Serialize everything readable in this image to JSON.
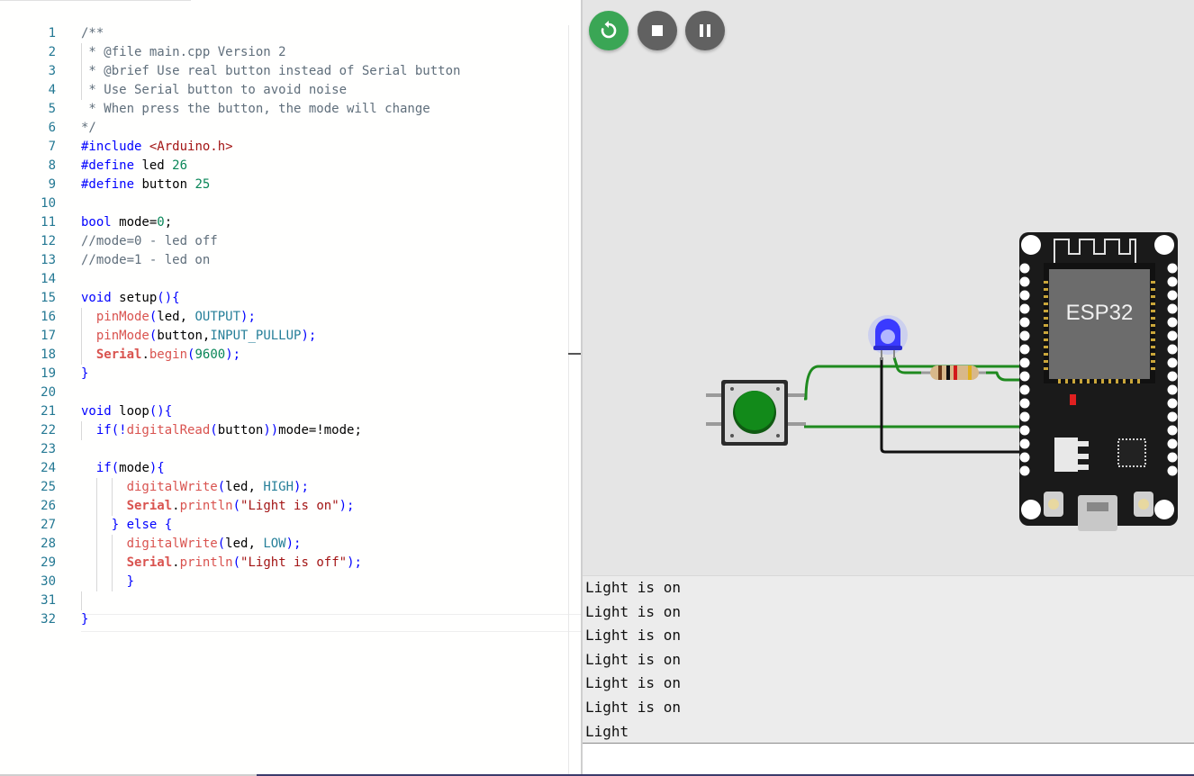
{
  "editor": {
    "lines": [
      "/**",
      " * @file main.cpp Version 2",
      " * @brief Use real button instead of Serial button",
      " * Use Serial button to avoid noise",
      " * When press the button, the mode will change",
      "*/",
      "#include <Arduino.h>",
      "#define led 26",
      "#define button 25",
      "",
      "bool mode=0;",
      "//mode=0 - led off",
      "//mode=1 - led on",
      "",
      "void setup(){",
      "  pinMode(led, OUTPUT);",
      "  pinMode(button,INPUT_PULLUP);",
      "  Serial.begin(9600);",
      "}",
      "",
      "void loop(){",
      "  if(!digitalRead(button))mode=!mode;",
      "",
      "  if(mode){",
      "      digitalWrite(led, HIGH);",
      "      Serial.println(\"Light is on\");",
      "    } else {",
      "      digitalWrite(led, LOW);",
      "      Serial.println(\"Light is off\");",
      "      }",
      "",
      "}"
    ],
    "line_numbers": [
      "1",
      "2",
      "3",
      "4",
      "5",
      "6",
      "7",
      "8",
      "9",
      "10",
      "11",
      "12",
      "13",
      "14",
      "15",
      "16",
      "17",
      "18",
      "19",
      "20",
      "21",
      "22",
      "23",
      "24",
      "25",
      "26",
      "27",
      "28",
      "29",
      "30",
      "31",
      "32"
    ]
  },
  "simulator": {
    "controls": {
      "restart_icon": "restart-icon",
      "stop_icon": "stop-icon",
      "pause_icon": "pause-icon"
    },
    "board_label": "ESP32",
    "colors": {
      "run_button": "#3aa655",
      "control_button": "#616161",
      "wire_green": "#1f8a1f",
      "wire_black": "#111111",
      "led_blue": "#3a3aff",
      "board": "#1a1a1a",
      "canvas": "#e5e5e5"
    }
  },
  "serial_monitor": {
    "lines": [
      "Light is on",
      "Light is on",
      "Light is on",
      "Light is on",
      "Light is on",
      "Light is on",
      "Light"
    ],
    "input_value": ""
  }
}
